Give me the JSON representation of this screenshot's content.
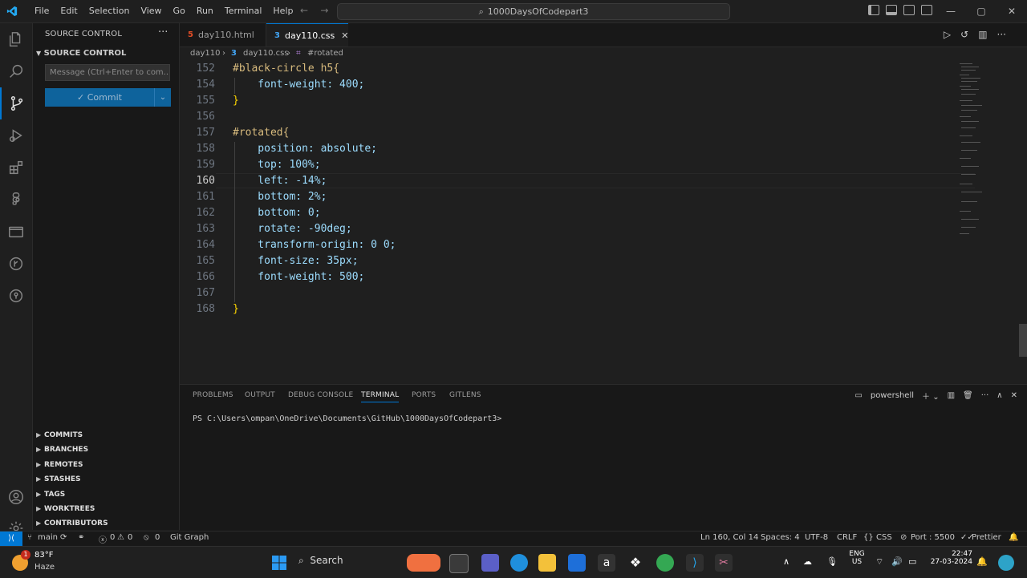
{
  "titlebar": {
    "menu": [
      "File",
      "Edit",
      "Selection",
      "View",
      "Go",
      "Run",
      "Terminal",
      "Help"
    ],
    "search_text": "1000DaysOfCodepart3"
  },
  "sidebar": {
    "title": "SOURCE CONTROL",
    "section": "SOURCE CONTROL",
    "message_placeholder": "Message (Ctrl+Enter to com...",
    "commit_label": "Commit",
    "groups": [
      "COMMITS",
      "BRANCHES",
      "REMOTES",
      "STASHES",
      "TAGS",
      "WORKTREES",
      "CONTRIBUTORS"
    ]
  },
  "tabs": [
    {
      "name": "day110.html",
      "icon": "html5-icon",
      "active": false
    },
    {
      "name": "day110.css",
      "icon": "css3-icon",
      "active": true
    }
  ],
  "breadcrumb": {
    "folder": "day110",
    "file": "day110.css",
    "symbol": "#rotated"
  },
  "editor": {
    "lines": [
      {
        "n": "152",
        "text": "#black-circle h5{"
      },
      {
        "n": "154",
        "text": "    font-weight: 400;"
      },
      {
        "n": "155",
        "text": "}"
      },
      {
        "n": "156",
        "text": ""
      },
      {
        "n": "157",
        "text": "#rotated{"
      },
      {
        "n": "158",
        "text": "    position: absolute;"
      },
      {
        "n": "159",
        "text": "    top: 100%;"
      },
      {
        "n": "160",
        "text": "    left: -14%;"
      },
      {
        "n": "161",
        "text": "    bottom: 2%;"
      },
      {
        "n": "162",
        "text": "    bottom: 0;"
      },
      {
        "n": "163",
        "text": "    rotate: -90deg;"
      },
      {
        "n": "164",
        "text": "    transform-origin: 0 0;"
      },
      {
        "n": "165",
        "text": "    font-size: 35px;"
      },
      {
        "n": "166",
        "text": "    font-weight: 500;"
      },
      {
        "n": "167",
        "text": ""
      },
      {
        "n": "168",
        "text": "}"
      }
    ],
    "current_line": "160"
  },
  "panel": {
    "tabs": [
      "PROBLEMS",
      "OUTPUT",
      "DEBUG CONSOLE",
      "TERMINAL",
      "PORTS",
      "GITLENS"
    ],
    "active_tab": "TERMINAL",
    "shell": "powershell",
    "prompt": "PS C:\\Users\\ompan\\OneDrive\\Documents\\GitHub\\1000DaysOfCodepart3>"
  },
  "statusbar": {
    "branch": "main",
    "errors": "0",
    "warnings": "0",
    "ports_count": "0",
    "git_graph": "Git Graph",
    "position": "Ln 160, Col 14",
    "spaces": "Spaces: 4",
    "encoding": "UTF-8",
    "eol": "CRLF",
    "language": "CSS",
    "port": "Port : 5500",
    "formatter": "Prettier"
  },
  "taskbar": {
    "weather_temp": "83°F",
    "weather_desc": "Haze",
    "weather_badge": "1",
    "search_label": "Search",
    "lang_top": "ENG",
    "lang_bottom": "US",
    "time": "22:47",
    "date": "27-03-2024"
  },
  "colors": {
    "accent": "#0078d4",
    "commit_button": "#0e639c",
    "selector": "#d7ba7d",
    "property": "#9cdcfe",
    "value": "#ce9178"
  }
}
